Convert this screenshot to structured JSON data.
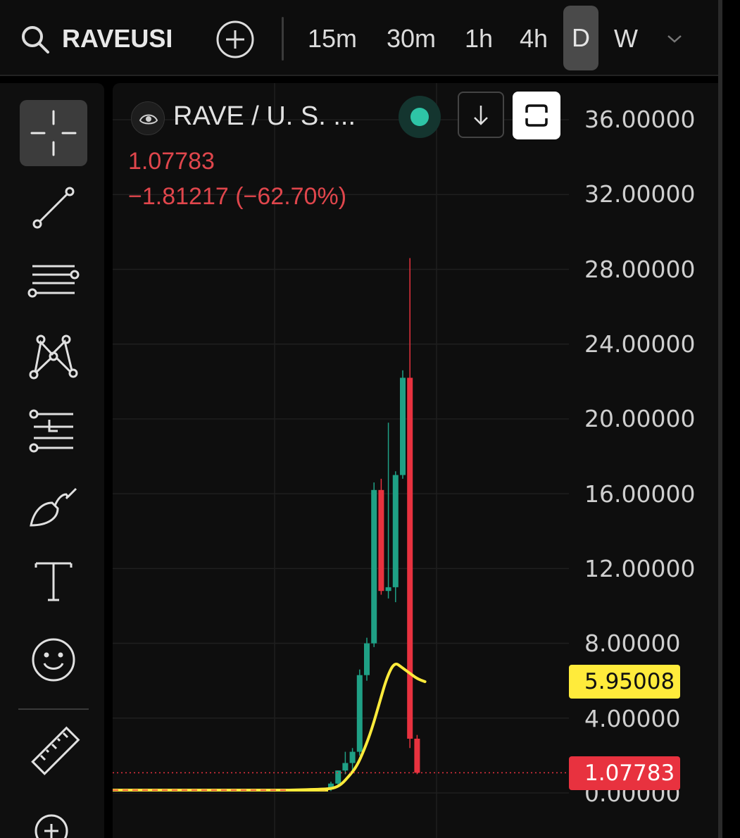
{
  "toolbar": {
    "symbol": "RAVEUSI",
    "timeframes": [
      "15m",
      "30m",
      "1h",
      "4h",
      "D",
      "W"
    ],
    "active_timeframe": "D"
  },
  "sidebar": {
    "tools": [
      "crosshair",
      "trend-line",
      "parallel-lines",
      "pattern",
      "long-position",
      "brush",
      "text",
      "emoji",
      "ruler",
      "zoom-in"
    ],
    "active_tool": "crosshair"
  },
  "legend": {
    "pair": "RAVE / U. S. ...",
    "price": "1.07783",
    "change": "−1.81217 (−62.70%)"
  },
  "price_axis": {
    "labels": [
      "36.00000",
      "32.00000",
      "28.00000",
      "24.00000",
      "20.00000",
      "16.00000",
      "12.00000",
      "8.00000",
      "4.00000",
      "0.00000"
    ],
    "ma_badge": "5.95008",
    "last_price_badge": "1.07783"
  },
  "colors": {
    "up": "#1fa085",
    "down": "#e8323f",
    "ma": "#ffeb3b",
    "background": "#0e0e0e"
  },
  "chart_data": {
    "type": "candlestick",
    "ylim": [
      0,
      36
    ],
    "candles": [
      {
        "o": 0.2,
        "h": 0.6,
        "l": 0.1,
        "c": 0.5
      },
      {
        "o": 0.5,
        "h": 1.2,
        "l": 0.4,
        "c": 1.2
      },
      {
        "o": 1.2,
        "h": 2.2,
        "l": 1.0,
        "c": 1.6
      },
      {
        "o": 1.6,
        "h": 2.4,
        "l": 1.2,
        "c": 2.2
      },
      {
        "o": 2.2,
        "h": 6.6,
        "l": 2.0,
        "c": 6.3
      },
      {
        "o": 6.3,
        "h": 8.3,
        "l": 6.0,
        "c": 8.0
      },
      {
        "o": 8.0,
        "h": 16.6,
        "l": 7.8,
        "c": 16.2
      },
      {
        "o": 16.2,
        "h": 16.8,
        "l": 10.6,
        "c": 10.8
      },
      {
        "o": 10.8,
        "h": 19.8,
        "l": 10.4,
        "c": 11.0
      },
      {
        "o": 11.0,
        "h": 17.2,
        "l": 10.2,
        "c": 17.0
      },
      {
        "o": 17.0,
        "h": 22.6,
        "l": 16.8,
        "c": 22.2
      },
      {
        "o": 22.2,
        "h": 28.6,
        "l": 2.4,
        "c": 2.9
      },
      {
        "o": 2.9,
        "h": 3.1,
        "l": 1.0,
        "c": 1.07783
      }
    ],
    "moving_average": {
      "name": "",
      "last_value": 5.95008
    },
    "last_price": 1.07783
  }
}
